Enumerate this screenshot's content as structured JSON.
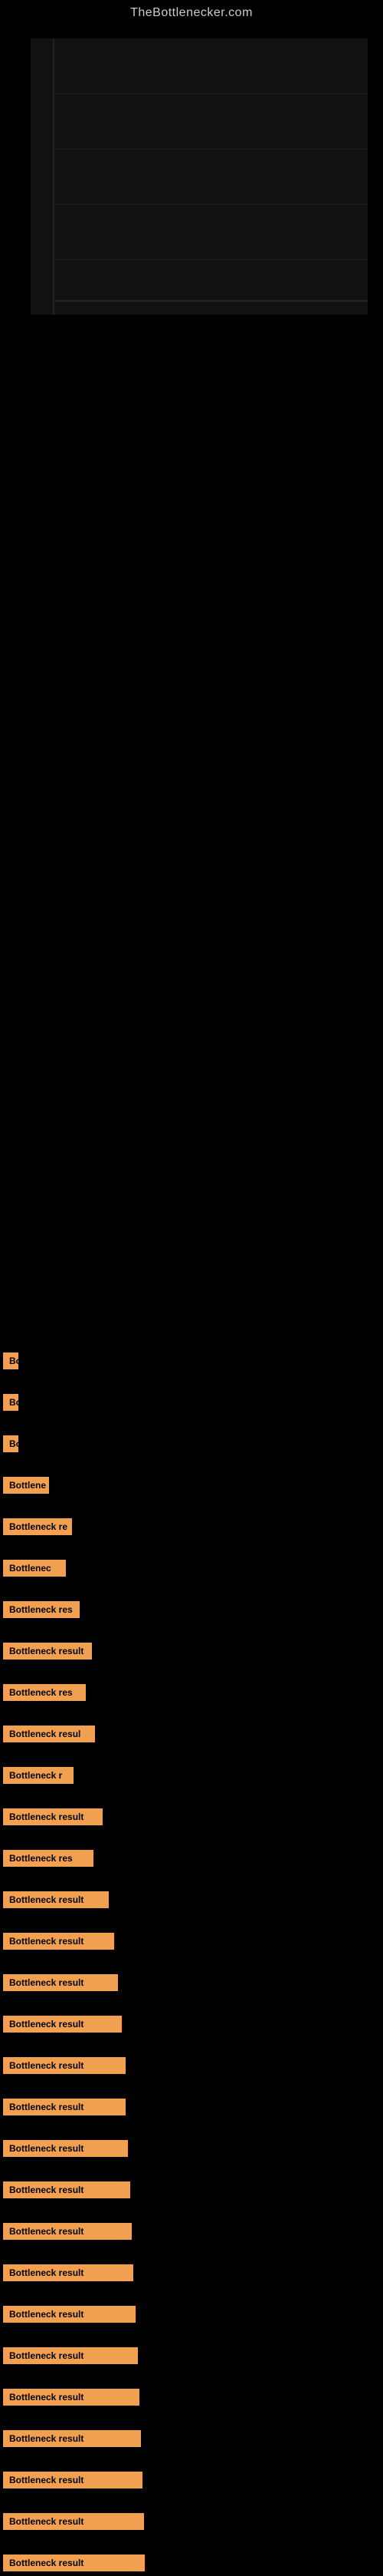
{
  "site": {
    "title": "TheBottlenecker.com"
  },
  "bottleneck_items": [
    {
      "id": 1,
      "label": "Bo",
      "bar_class": "bar-w-20",
      "margin_top": 1300
    },
    {
      "id": 2,
      "label": "Bo",
      "bar_class": "bar-w-20",
      "margin_top": 30
    },
    {
      "id": 3,
      "label": "Bo",
      "bar_class": "bar-w-20",
      "margin_top": 30
    },
    {
      "id": 4,
      "label": "Bottlene",
      "bar_class": "bar-w-60",
      "margin_top": 30
    },
    {
      "id": 5,
      "label": "Bottleneck re",
      "bar_class": "bar-w-90",
      "margin_top": 30
    },
    {
      "id": 6,
      "label": "Bottlenec",
      "bar_class": "bar-w-80",
      "margin_top": 30
    },
    {
      "id": 7,
      "label": "Bottleneck res",
      "bar_class": "bar-w-100",
      "margin_top": 30
    },
    {
      "id": 8,
      "label": "Bottleneck result",
      "bar_class": "bar-w-120",
      "margin_top": 30
    },
    {
      "id": 9,
      "label": "Bottleneck res",
      "bar_class": "bar-w-110",
      "margin_top": 30
    },
    {
      "id": 10,
      "label": "Bottleneck resul",
      "bar_class": "bar-w-120",
      "margin_top": 30
    },
    {
      "id": 11,
      "label": "Bottleneck r",
      "bar_class": "bar-w-90",
      "margin_top": 30
    },
    {
      "id": 12,
      "label": "Bottleneck result",
      "bar_class": "bar-w-130",
      "margin_top": 30
    },
    {
      "id": 13,
      "label": "Bottleneck res",
      "bar_class": "bar-w-120",
      "margin_top": 30
    },
    {
      "id": 14,
      "label": "Bottleneck result",
      "bar_class": "bar-w-140",
      "margin_top": 30
    },
    {
      "id": 15,
      "label": "Bottleneck result",
      "bar_class": "bar-w-145",
      "margin_top": 30
    },
    {
      "id": 16,
      "label": "Bottleneck result",
      "bar_class": "bar-w-150",
      "margin_top": 30
    },
    {
      "id": 17,
      "label": "Bottleneck result",
      "bar_class": "bar-w-155",
      "margin_top": 30
    },
    {
      "id": 18,
      "label": "Bottleneck result",
      "bar_class": "bar-w-160",
      "margin_top": 30
    },
    {
      "id": 19,
      "label": "Bottleneck result",
      "bar_class": "bar-w-160",
      "margin_top": 30
    },
    {
      "id": 20,
      "label": "Bottleneck result",
      "bar_class": "bar-w-165",
      "margin_top": 30
    },
    {
      "id": 21,
      "label": "Bottleneck result",
      "bar_class": "bar-w-168",
      "margin_top": 30
    },
    {
      "id": 22,
      "label": "Bottleneck result",
      "bar_class": "bar-w-170",
      "margin_top": 30
    },
    {
      "id": 23,
      "label": "Bottleneck result",
      "bar_class": "bar-w-172",
      "margin_top": 30
    },
    {
      "id": 24,
      "label": "Bottleneck result",
      "bar_class": "bar-w-175",
      "margin_top": 30
    },
    {
      "id": 25,
      "label": "Bottleneck result",
      "bar_class": "bar-w-178",
      "margin_top": 30
    },
    {
      "id": 26,
      "label": "Bottleneck result",
      "bar_class": "bar-w-180",
      "margin_top": 30
    },
    {
      "id": 27,
      "label": "Bottleneck result",
      "bar_class": "bar-w-182",
      "margin_top": 30
    },
    {
      "id": 28,
      "label": "Bottleneck result",
      "bar_class": "bar-w-185",
      "margin_top": 30
    },
    {
      "id": 29,
      "label": "Bottleneck result",
      "bar_class": "bar-w-185",
      "margin_top": 30
    },
    {
      "id": 30,
      "label": "Bottleneck result",
      "bar_class": "bar-w-185",
      "margin_top": 30
    }
  ]
}
